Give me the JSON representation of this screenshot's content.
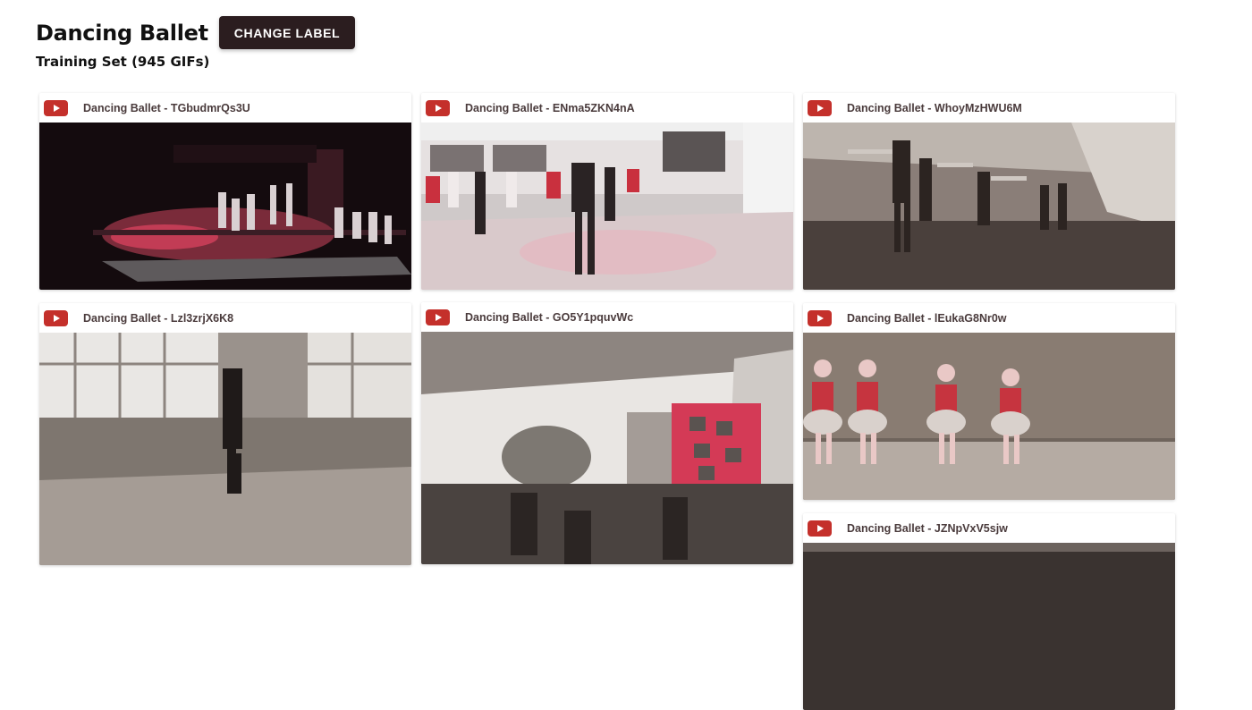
{
  "header": {
    "title": "Dancing Ballet",
    "change_label": "CHANGE LABEL",
    "subtitle": "Training Set (945 GIFs)"
  },
  "colors": {
    "youtube_red": "#c4302b",
    "button_bg": "#2b1d1f"
  },
  "cards": [
    {
      "label": "Dancing Ballet - TGbudmrQs3U",
      "icon": "youtube-icon"
    },
    {
      "label": "Dancing Ballet - ENma5ZKN4nA",
      "icon": "youtube-icon"
    },
    {
      "label": "Dancing Ballet - WhoyMzHWU6M",
      "icon": "youtube-icon"
    },
    {
      "label": "Dancing Ballet - Lzl3zrjX6K8",
      "icon": "youtube-icon"
    },
    {
      "label": "Dancing Ballet - GO5Y1pquvWc",
      "icon": "youtube-icon"
    },
    {
      "label": "Dancing Ballet - lEukaG8Nr0w",
      "icon": "youtube-icon"
    },
    {
      "label": "Dancing Ballet - JZNpVxV5sjw",
      "icon": "youtube-icon"
    }
  ]
}
